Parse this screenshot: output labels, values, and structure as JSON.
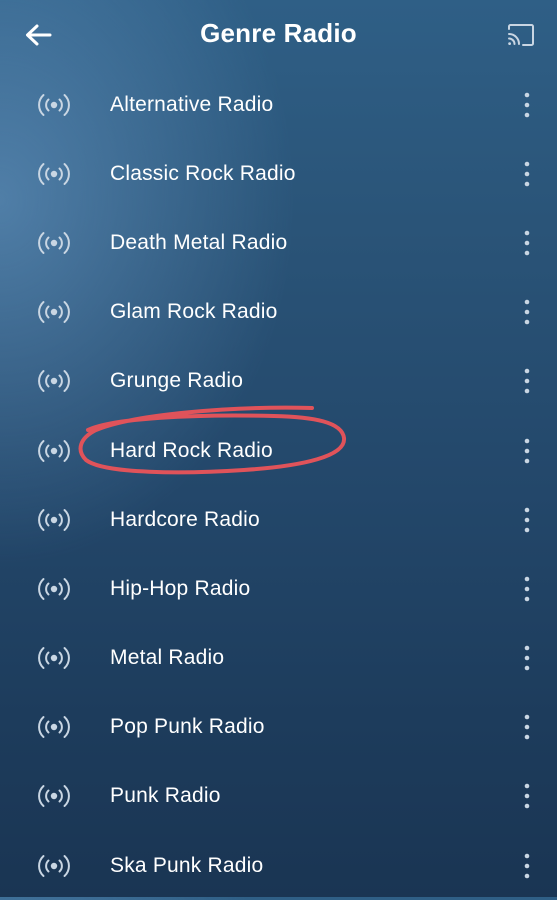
{
  "header": {
    "title": "Genre Radio",
    "back_icon": "arrow-left-icon",
    "cast_icon": "cast-icon"
  },
  "colors": {
    "text": "#ffffff",
    "icon": "#c9d6e3",
    "annotation": "#e0535a"
  },
  "stations": [
    {
      "label": "Alternative Radio"
    },
    {
      "label": "Classic Rock Radio"
    },
    {
      "label": "Death Metal Radio"
    },
    {
      "label": "Glam Rock Radio"
    },
    {
      "label": "Grunge Radio"
    },
    {
      "label": "Hard Rock Radio",
      "circled": true
    },
    {
      "label": "Hardcore Radio"
    },
    {
      "label": "Hip-Hop Radio"
    },
    {
      "label": "Metal Radio"
    },
    {
      "label": "Pop Punk Radio"
    },
    {
      "label": "Punk Radio"
    },
    {
      "label": "Ska Punk Radio"
    }
  ],
  "row_icon": "radio-broadcast-icon",
  "row_menu_icon": "more-vert-icon"
}
